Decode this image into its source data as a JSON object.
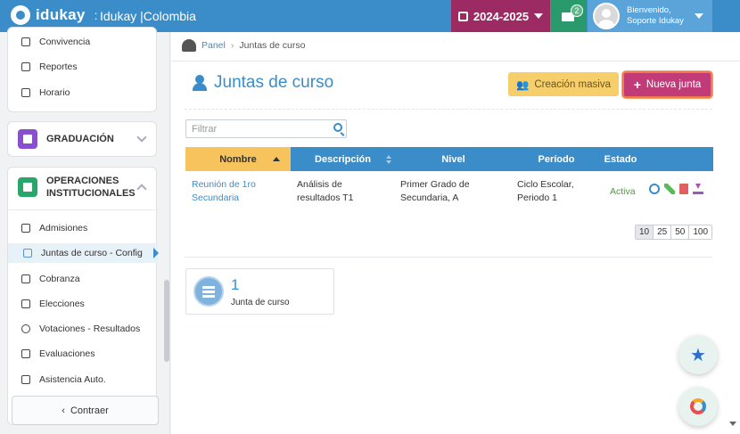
{
  "topbar": {
    "brand": "idukay",
    "brand_sep": ":",
    "school": "Idukay |Colombia",
    "year": "2024-2025",
    "messages_count": "2",
    "user_greeting": "Bienvenido,",
    "user_name": "Soporte Idukay",
    "brand_color": "#3a8dc8"
  },
  "sidebar": {
    "top_items": [
      {
        "label": "Convivencia",
        "icon": "list-icon"
      },
      {
        "label": "Reportes",
        "icon": "chart-icon"
      },
      {
        "label": "Horario",
        "icon": "calendar-icon"
      }
    ],
    "graduacion": "GRADUACIÓN",
    "operaciones": "OPERACIONES INSTITUCIONALES",
    "op_items": [
      {
        "label": "Admisiones",
        "icon": "user-plus-icon"
      },
      {
        "label": "Juntas de curso - Config",
        "icon": "group-icon"
      },
      {
        "label": "Cobranza",
        "icon": "money-icon"
      },
      {
        "label": "Elecciones",
        "icon": "vote-icon"
      },
      {
        "label": "Votaciones - Resultados",
        "icon": "check-circle-icon"
      },
      {
        "label": "Evaluaciones",
        "icon": "clipboard-icon"
      },
      {
        "label": "Asistencia Auto.",
        "icon": "calendar-check-icon"
      }
    ],
    "collapse": "Contraer"
  },
  "breadcrumb": {
    "home": "Panel",
    "current": "Juntas de curso"
  },
  "page": {
    "title": "Juntas de curso",
    "bulk_button": "Creación masiva",
    "new_button": "Nueva junta",
    "filter_placeholder": "Filtrar"
  },
  "table": {
    "columns": [
      "Nombre",
      "Descripción",
      "Nivel",
      "Período",
      "Estado"
    ],
    "rows": [
      {
        "nombre": "Reunión de 1ro Secundaria",
        "descripcion": "Análisis de resultados T1",
        "nivel": "Primer Grado de Secundaria, A",
        "periodo": "Ciclo Escolar, Periodo 1",
        "estado": "Activa"
      }
    ],
    "page_sizes": [
      "10",
      "25",
      "50",
      "100"
    ]
  },
  "summary": {
    "count": "1",
    "label": "Junta de curso"
  }
}
